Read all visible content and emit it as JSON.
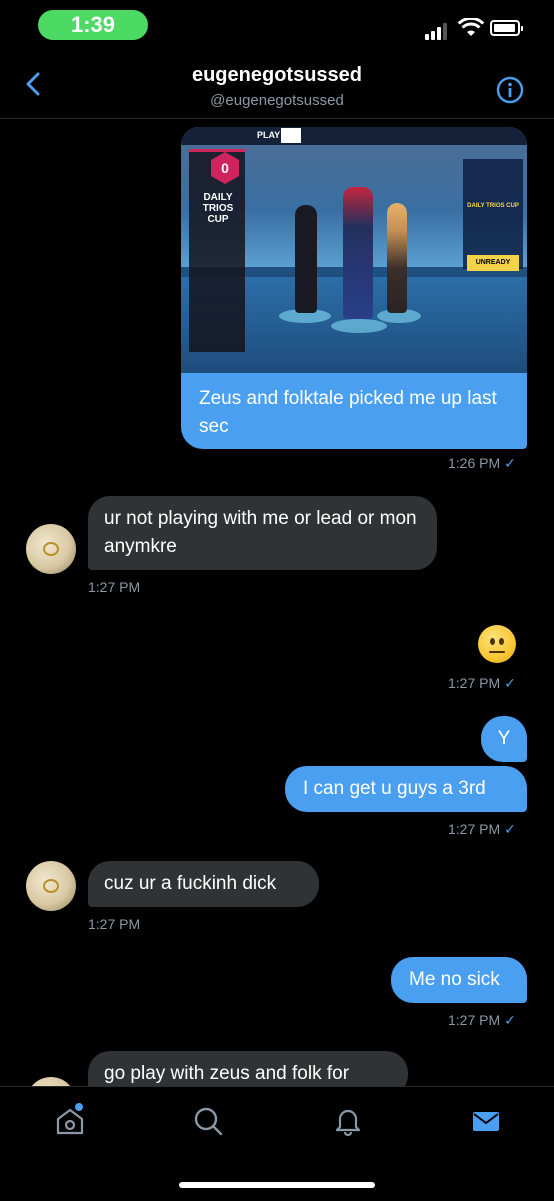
{
  "status_bar": {
    "time": "1:39",
    "time_pill_color": "#4cd964",
    "battery_level": 0.85
  },
  "header": {
    "title": "eugenegotsussed",
    "handle": "@eugenegotsussed",
    "back_icon": "chevron-left-icon",
    "info_icon": "info-icon",
    "accent_color": "#4a9ff0"
  },
  "media": {
    "top_bar_label": "PLAY",
    "badge_number": "0",
    "cup_title": "DAILY TRIOS CUP",
    "right_panel_title": "DAILY TRIOS CUP",
    "unready_label": "UNREADY"
  },
  "messages": [
    {
      "direction": "out",
      "type": "image_with_text",
      "text": "Zeus and folktale picked me up last sec",
      "time": "1:26 PM"
    },
    {
      "direction": "in",
      "text": "ur not playing with me or lead or mon anymkre",
      "time": "1:27 PM"
    },
    {
      "direction": "out",
      "type": "emoji",
      "emoji": "neutral-face",
      "time": "1:27 PM"
    },
    {
      "direction": "out",
      "text": "Y"
    },
    {
      "direction": "out",
      "text": "I can get u guys a 3rd",
      "time": "1:27 PM"
    },
    {
      "direction": "in",
      "text": "cuz ur a fuckinh dick",
      "time": "1:27 PM"
    },
    {
      "direction": "out",
      "text": "Me no sick",
      "time": "1:27 PM"
    },
    {
      "direction": "in",
      "text": "go play with zeus and folk for"
    }
  ],
  "read_check": "✓",
  "tab_bar": {
    "items": [
      "home-icon",
      "search-icon",
      "notifications-bell-icon",
      "messages-envelope-icon"
    ],
    "active": "messages-envelope-icon"
  }
}
